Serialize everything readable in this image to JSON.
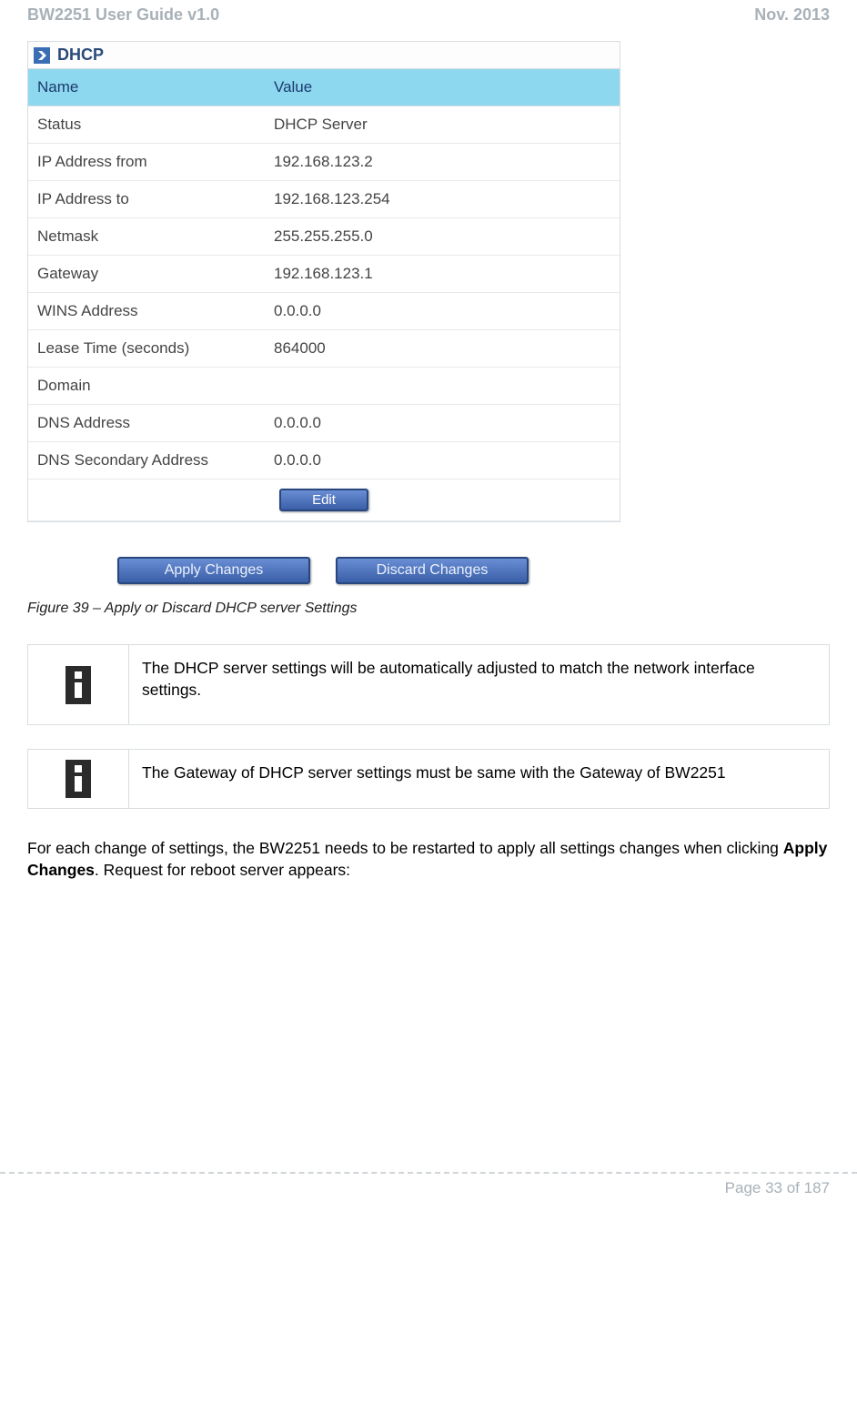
{
  "header": {
    "left": "BW2251 User Guide v1.0",
    "right": "Nov.  2013"
  },
  "panel": {
    "title": "DHCP",
    "columns": {
      "name": "Name",
      "value": "Value"
    },
    "rows": [
      {
        "name": "Status",
        "value": "DHCP Server"
      },
      {
        "name": "IP Address from",
        "value": "192.168.123.2"
      },
      {
        "name": "IP Address to",
        "value": "192.168.123.254"
      },
      {
        "name": "Netmask",
        "value": "255.255.255.0"
      },
      {
        "name": "Gateway",
        "value": "192.168.123.1"
      },
      {
        "name": "WINS Address",
        "value": "0.0.0.0"
      },
      {
        "name": "Lease Time (seconds)",
        "value": "864000"
      },
      {
        "name": "Domain",
        "value": ""
      },
      {
        "name": "DNS Address",
        "value": "0.0.0.0"
      },
      {
        "name": "DNS Secondary Address",
        "value": "0.0.0.0"
      }
    ],
    "edit_label": "Edit"
  },
  "action_buttons": {
    "apply": "Apply Changes",
    "discard": "Discard Changes"
  },
  "caption": "Figure 39 – Apply or Discard DHCP server Settings",
  "notes": {
    "n1": "The DHCP server settings will be automatically adjusted to match the network interface settings.",
    "n2": "The Gateway of DHCP server settings must be same with the Gateway of BW2251"
  },
  "body": {
    "p1a": "For each change of settings, the BW2251 needs to be restarted to apply all settings changes when clicking ",
    "p1b": "Apply Changes",
    "p1c": ". Request for reboot server appears:"
  },
  "footer": "Page 33 of 187"
}
